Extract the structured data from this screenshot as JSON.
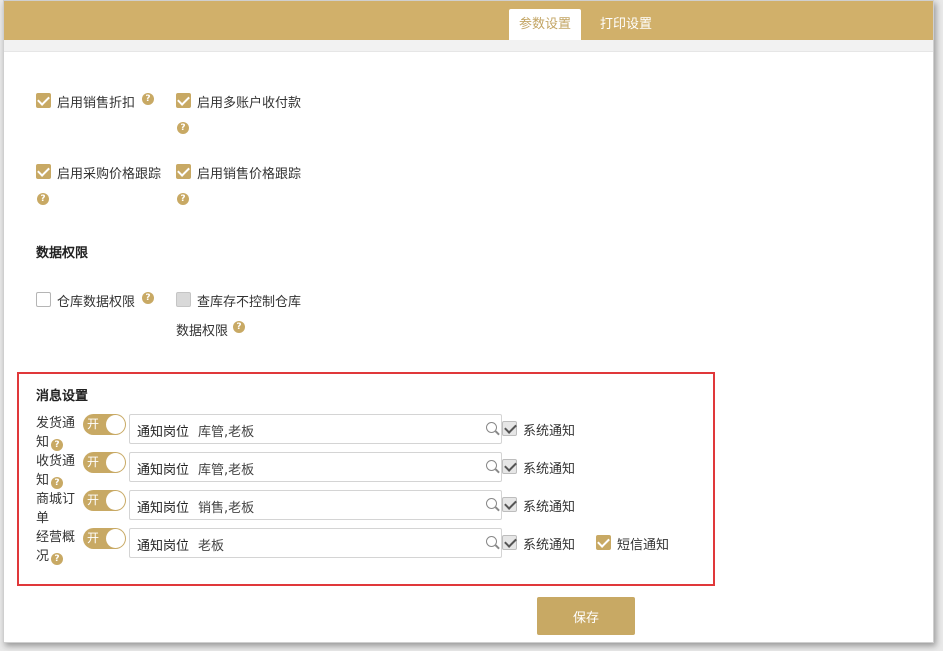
{
  "tabs": [
    {
      "label": "参数设置",
      "active": true
    },
    {
      "label": "打印设置",
      "active": false
    }
  ],
  "options": [
    {
      "label": "启用销售折扣",
      "checked": true
    },
    {
      "label": "启用多账户收付款",
      "checked": true
    },
    {
      "label": "启用采购价格跟踪",
      "checked": true
    },
    {
      "label": "启用销售价格跟踪",
      "checked": true
    }
  ],
  "data_permissions": {
    "title": "数据权限",
    "items": [
      {
        "label": "仓库数据权限",
        "checked": false
      },
      {
        "label_line1": "查库存不控制仓库",
        "label_line2": "数据权限",
        "checked": false,
        "disabled": true
      }
    ]
  },
  "message_settings": {
    "title": "消息设置",
    "rows": [
      {
        "name_line1": "发货通",
        "name_line2": "知",
        "toggle": "开",
        "field_label": "通知岗位",
        "field_value": "库管,老板",
        "system_notify": "系统通知"
      },
      {
        "name_line1": "收货通",
        "name_line2": "知",
        "toggle": "开",
        "field_label": "通知岗位",
        "field_value": "库管,老板",
        "system_notify": "系统通知"
      },
      {
        "name_line1": "商城订",
        "name_line2": "单",
        "toggle": "开",
        "field_label": "通知岗位",
        "field_value": "销售,老板",
        "system_notify": "系统通知"
      },
      {
        "name_line1": "经营概",
        "name_line2": "况",
        "toggle": "开",
        "field_label": "通知岗位",
        "field_value": "老板",
        "system_notify": "系统通知",
        "sms_notify": "短信通知"
      }
    ]
  },
  "save_label": "保存",
  "colors": {
    "accent": "#c8a964",
    "header": "#d1b06a",
    "highlight_box": "#e0383a"
  }
}
